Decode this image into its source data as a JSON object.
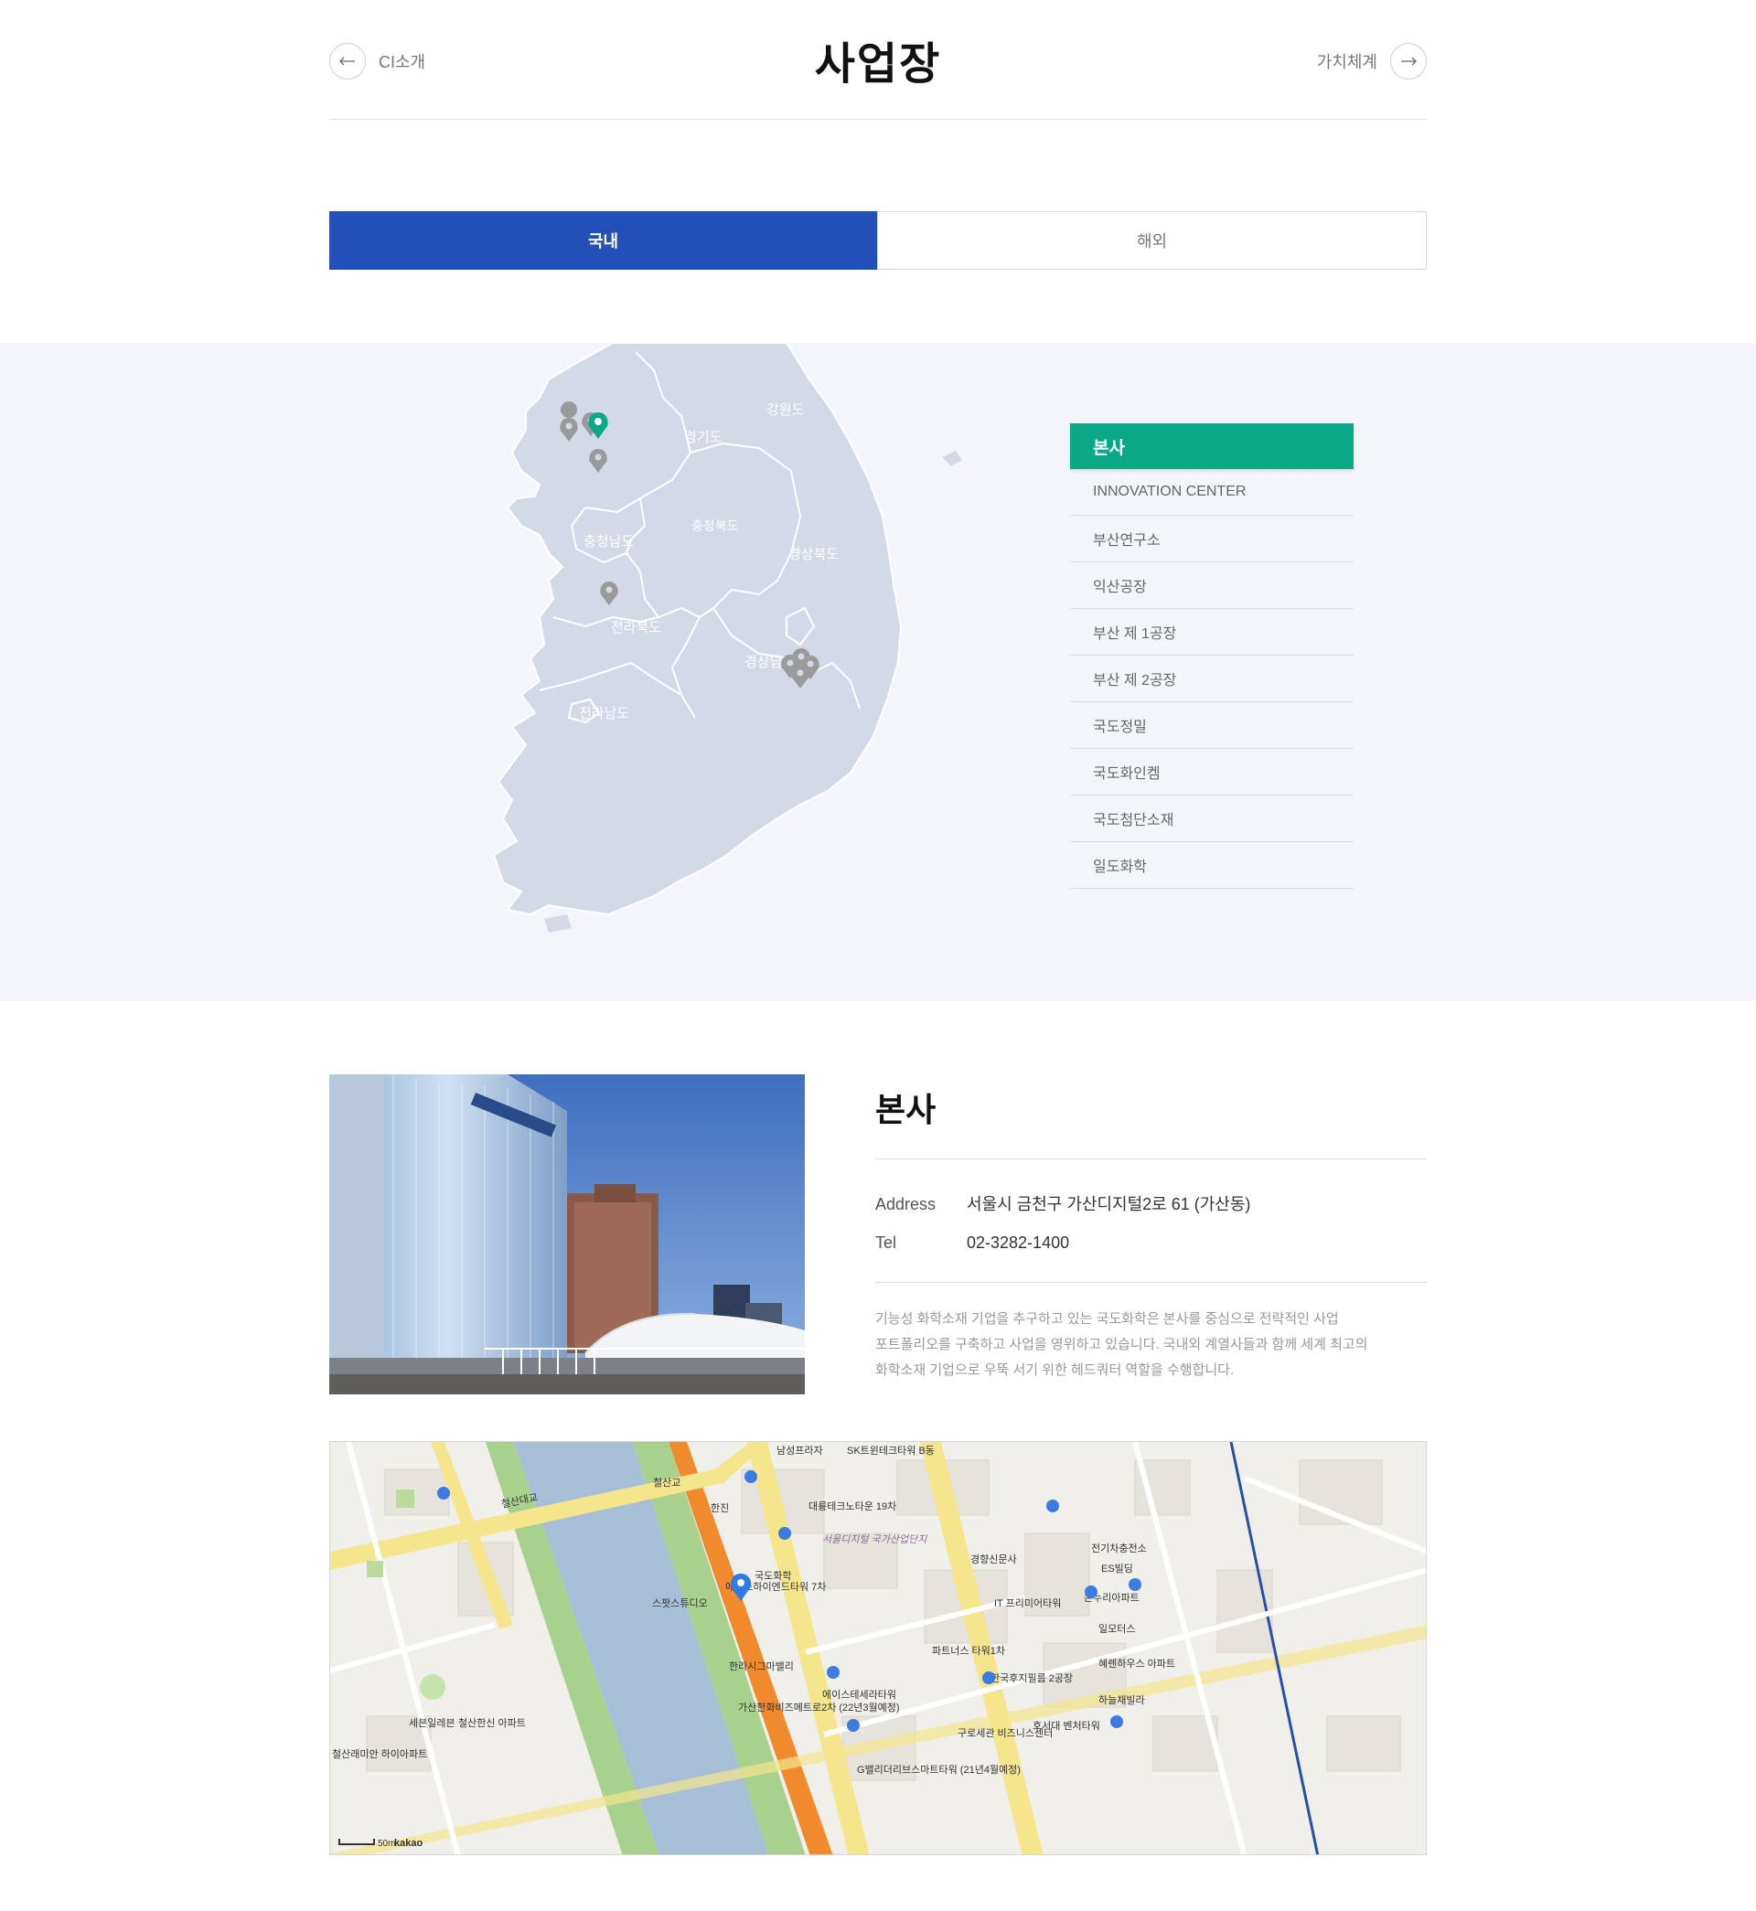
{
  "header": {
    "title": "사업장",
    "prev_label": "CI소개",
    "next_label": "가치체계"
  },
  "tabs": [
    {
      "label": "국내",
      "active": true
    },
    {
      "label": "해외",
      "active": false
    }
  ],
  "map_regions": [
    "강원도",
    "경기도",
    "충청북도",
    "충청남도",
    "경상북도",
    "전라북도",
    "경상남도",
    "전라남도"
  ],
  "sites": [
    {
      "label": "본사",
      "active": true
    },
    {
      "label": "INNOVATION CENTER"
    },
    {
      "label": "부산연구소"
    },
    {
      "label": "익산공장"
    },
    {
      "label": "부산 제 1공장"
    },
    {
      "label": "부산 제 2공장"
    },
    {
      "label": "국도정밀"
    },
    {
      "label": "국도화인켐"
    },
    {
      "label": "국도첨단소재"
    },
    {
      "label": "일도화학"
    }
  ],
  "detail": {
    "title": "본사",
    "address_label": "Address",
    "address": "서울시 금천구 가산디지털2로 61 (가산동)",
    "tel_label": "Tel",
    "tel": "02-3282-1400",
    "description_lines": [
      "기능성 화학소재 기업을 추구하고 있는 국도화학은 본사를 중심으로 전략적인 사업",
      "포트폴리오를 구축하고 사업을 영위하고 있습니다. 국내외 계열사들과 함께 세계 최고의",
      "화학소재 기업으로 우뚝 서기 위한 헤드쿼터 역할을 수행합니다."
    ]
  },
  "location_map": {
    "marker_label": "국도화학",
    "labels": [
      "남성프라자",
      "SK트윈테크타워 B동",
      "한진",
      "대륭테크노타운 19차",
      "서울디지털 국가산업단지",
      "경향신문사",
      "전기차충전소",
      "ES빌딩",
      "에이스하이엔드타워 7차",
      "온누리아파트",
      "스팟스튜디오",
      "IT 프리미어타워",
      "일모터스",
      "한라시그마밸리",
      "파트너스 타워1차",
      "혜렌하우스 아파트",
      "한국후지필름 2공장",
      "하늘채빌라",
      "에이스테세라타워",
      "가산한화비즈메트로2차 (22년3월예정)",
      "구로세관 비즈니스센터",
      "호서대 벤처타워",
      "G밸리더리브스마트타워 (21년4월예정)",
      "세븐일레븐",
      "철산한신 아파트",
      "철산래미안 하이아파트",
      "철산대교",
      "철산교"
    ],
    "scale": "50m",
    "brand": "kakao"
  }
}
